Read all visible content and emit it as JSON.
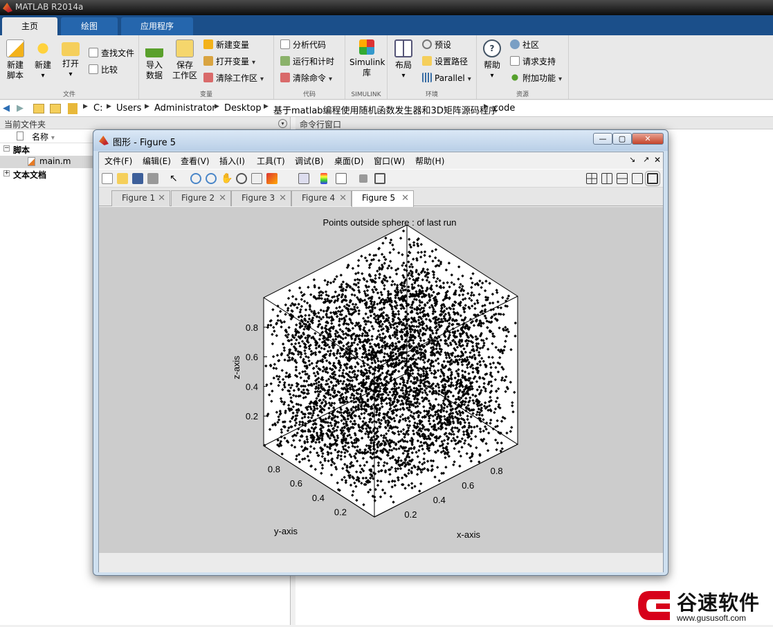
{
  "app": {
    "title": "MATLAB R2014a"
  },
  "ribbon_tabs": [
    {
      "label": "主页"
    },
    {
      "label": "绘图"
    },
    {
      "label": "应用程序"
    }
  ],
  "ribbon": {
    "file": {
      "label": "文件",
      "new_script": "新建\n脚本",
      "new": "新建",
      "open": "打开",
      "find_files": "查找文件",
      "compare": "比较"
    },
    "variable": {
      "label": "变量",
      "import": "导入\n数据",
      "save_ws": "保存\n工作区",
      "new_var": "新建变量",
      "open_var": "打开变量",
      "clear_ws": "清除工作区"
    },
    "code": {
      "label": "代码",
      "analyze": "分析代码",
      "run_time": "运行和计时",
      "clear_cmd": "清除命令"
    },
    "simulink": {
      "label": "SIMULINK",
      "lib": "Simulink\n库"
    },
    "env": {
      "label": "环境",
      "layout": "布局",
      "prefs": "预设",
      "set_path": "设置路径",
      "parallel": "Parallel"
    },
    "resources": {
      "label": "资源",
      "help": "帮助",
      "community": "社区",
      "support": "请求支持",
      "addons": "附加功能"
    }
  },
  "address": {
    "crumbs": [
      "C:",
      "Users",
      "Administrator",
      "Desktop",
      "基于matlab编程使用随机函数发生器和3D矩阵源码程序",
      "code"
    ]
  },
  "left_panel": {
    "header": "当前文件夹",
    "col_name": "名称",
    "group_scripts": "脚本",
    "file_main": "main.m",
    "group_docs": "文本文档"
  },
  "right_panel": {
    "header": "命令行窗口"
  },
  "figure": {
    "caption": "图形 - Figure 5",
    "menus": [
      "文件(F)",
      "编辑(E)",
      "查看(V)",
      "插入(I)",
      "工具(T)",
      "调试(B)",
      "桌面(D)",
      "窗口(W)",
      "帮助(H)"
    ],
    "tabs": [
      "Figure 1",
      "Figure 2",
      "Figure 3",
      "Figure 4",
      "Figure 5"
    ],
    "active_tab": 4
  },
  "chart_data": {
    "type": "scatter",
    "title": "Points outside sphere : of last run",
    "xlabel": "x-axis",
    "ylabel": "y-axis",
    "zlabel": "z-axis",
    "x_ticks": [
      "0.2",
      "0.4",
      "0.6",
      "0.8"
    ],
    "y_ticks": [
      "0.2",
      "0.4",
      "0.6",
      "0.8"
    ],
    "z_ticks": [
      "0.2",
      "0.4",
      "0.6",
      "0.8"
    ],
    "xlim": [
      0,
      1
    ],
    "ylim": [
      0,
      1
    ],
    "zlim": [
      0,
      1
    ],
    "marker": "filled diamond",
    "marker_color": "#000000",
    "approx_points": 6000,
    "background": "#cccccc",
    "grid": false
  },
  "logo": {
    "cn": "谷速软件",
    "url": "www.gususoft.com",
    "brand_color": "#d7001a"
  }
}
